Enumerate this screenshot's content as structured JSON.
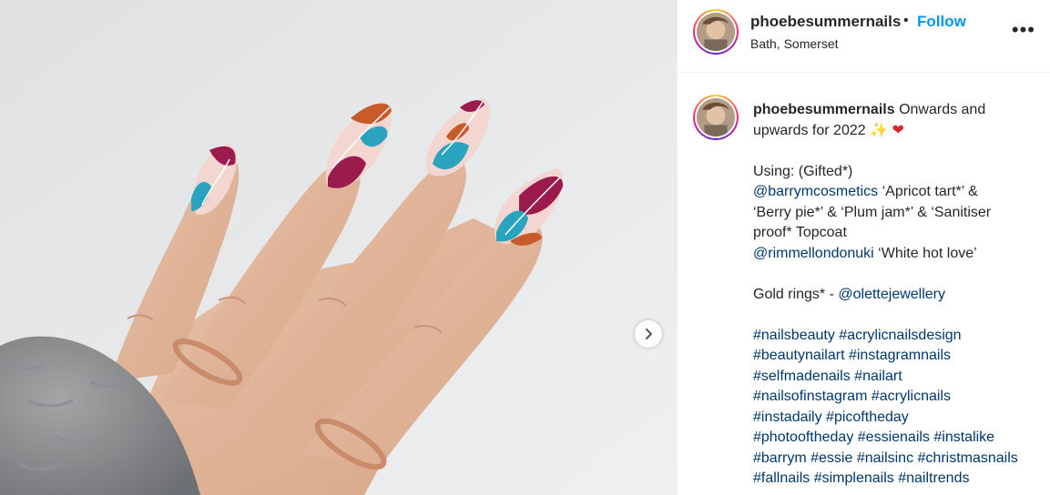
{
  "post": {
    "username": "phoebesummernails",
    "follow_label": "Follow",
    "separator": "•",
    "location": "Bath, Somerset",
    "more_label": "•••",
    "caption": {
      "intro": "Onwards and",
      "line2": "upwards for 2022 ✨",
      "line2_heart": "❤",
      "using": "Using: (Gifted*)",
      "mention1": "@barrymcosmetics",
      "mention1_rest": " ‘Apricot tart*’ &",
      "line_berry": "‘Berry pie*’ & ‘Plum jam*’ & ‘Sanitiser",
      "line_proof": "proof* Topcoat",
      "mention2": "@rimmellondonuki",
      "mention2_rest": " ‘White hot love’",
      "gold_prefix": "Gold rings* - ",
      "mention3": "@olettejewellery",
      "hashtags": [
        "#nailsbeauty #acrylicnailsdesign",
        "#beautynailart #instagramnails",
        "#selfmadenails #nailart",
        "#nailsofinstagram #acrylicnails",
        "#instadaily #picoftheday",
        "#photooftheday #essienails #instalike",
        "#barrym #essie #nailsinc #christmasnails",
        "#fallnails #simplenails #nailtrends"
      ]
    }
  },
  "icons": {
    "next": "chevron-right-icon",
    "more": "more-options-icon"
  },
  "colors": {
    "follow": "#0095f6",
    "link": "#00376b",
    "text": "#262626",
    "nail_berry": "#9b1b4d",
    "nail_teal": "#2aa3bf",
    "nail_orange": "#c95a2a",
    "nail_pink": "#f3d6cf"
  }
}
